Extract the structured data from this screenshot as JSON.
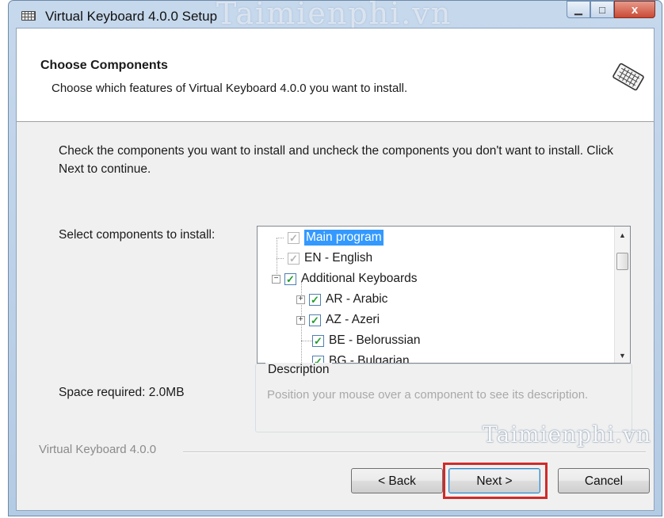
{
  "window": {
    "title": "Virtual Keyboard 4.0.0 Setup",
    "watermark_top": "Taimienphi.vn",
    "caption_buttons": {
      "minimize": "▁",
      "maximize": "□",
      "close": "x"
    }
  },
  "header": {
    "title": "Choose Components",
    "subtitle": "Choose which features of Virtual Keyboard 4.0.0 you want to install."
  },
  "instructions": "Check the components you want to install and uncheck the components you don't want to install. Click Next to continue.",
  "select_label": "Select components to install:",
  "components": [
    {
      "label": "Main program",
      "checked": true,
      "disabled": true,
      "selected": true,
      "expander": ""
    },
    {
      "label": "EN - English",
      "checked": true,
      "disabled": true,
      "selected": false,
      "expander": ""
    },
    {
      "label": "Additional Keyboards",
      "checked": true,
      "disabled": false,
      "selected": false,
      "expander": "−"
    },
    {
      "label": "AR - Arabic",
      "checked": true,
      "disabled": false,
      "selected": false,
      "expander": "+"
    },
    {
      "label": "AZ - Azeri",
      "checked": true,
      "disabled": false,
      "selected": false,
      "expander": "+"
    },
    {
      "label": "BE - Belorussian",
      "checked": true,
      "disabled": false,
      "selected": false,
      "expander": ""
    },
    {
      "label": "BG - Bulgarian",
      "checked": true,
      "disabled": false,
      "selected": false,
      "expander": ""
    }
  ],
  "description": {
    "title": "Description",
    "text": "Position your mouse over a component to see its description."
  },
  "space_required": "Space required: 2.0MB",
  "branding": "Virtual Keyboard 4.0.0",
  "watermark_bottom": "Taimienphi.vn",
  "buttons": {
    "back": "< Back",
    "next": "Next >",
    "cancel": "Cancel"
  },
  "icons": {
    "title": "keyboard-icon",
    "header": "keyboard-icon"
  },
  "colors": {
    "selection": "#3399ff",
    "highlight_frame": "#d02a2a",
    "check": "#1f9e2a"
  }
}
